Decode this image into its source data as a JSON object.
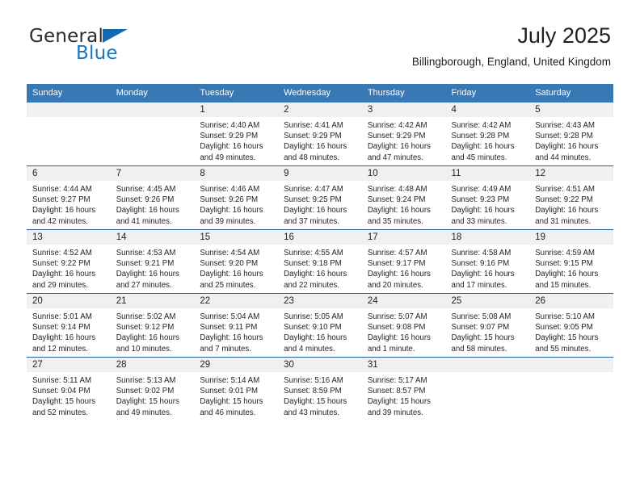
{
  "logo": {
    "word_top": "General",
    "word_bottom": "Blue",
    "triangle_icon": "triangle-icon",
    "blue": "#1b75bb"
  },
  "header": {
    "title": "July 2025",
    "subtitle": "Billingborough, England, United Kingdom"
  },
  "colors": {
    "header_row": "#3778b5",
    "day_band": "#f0f0f0",
    "row_divider": "#2a6099",
    "text": "#231f20"
  },
  "weekday_headers": [
    "Sunday",
    "Monday",
    "Tuesday",
    "Wednesday",
    "Thursday",
    "Friday",
    "Saturday"
  ],
  "weeks": [
    [
      {
        "day": "",
        "sunrise": "",
        "sunset": "",
        "daylight_1": "",
        "daylight_2": ""
      },
      {
        "day": "",
        "sunrise": "",
        "sunset": "",
        "daylight_1": "",
        "daylight_2": ""
      },
      {
        "day": "1",
        "sunrise": "Sunrise: 4:40 AM",
        "sunset": "Sunset: 9:29 PM",
        "daylight_1": "Daylight: 16 hours",
        "daylight_2": "and 49 minutes."
      },
      {
        "day": "2",
        "sunrise": "Sunrise: 4:41 AM",
        "sunset": "Sunset: 9:29 PM",
        "daylight_1": "Daylight: 16 hours",
        "daylight_2": "and 48 minutes."
      },
      {
        "day": "3",
        "sunrise": "Sunrise: 4:42 AM",
        "sunset": "Sunset: 9:29 PM",
        "daylight_1": "Daylight: 16 hours",
        "daylight_2": "and 47 minutes."
      },
      {
        "day": "4",
        "sunrise": "Sunrise: 4:42 AM",
        "sunset": "Sunset: 9:28 PM",
        "daylight_1": "Daylight: 16 hours",
        "daylight_2": "and 45 minutes."
      },
      {
        "day": "5",
        "sunrise": "Sunrise: 4:43 AM",
        "sunset": "Sunset: 9:28 PM",
        "daylight_1": "Daylight: 16 hours",
        "daylight_2": "and 44 minutes."
      }
    ],
    [
      {
        "day": "6",
        "sunrise": "Sunrise: 4:44 AM",
        "sunset": "Sunset: 9:27 PM",
        "daylight_1": "Daylight: 16 hours",
        "daylight_2": "and 42 minutes."
      },
      {
        "day": "7",
        "sunrise": "Sunrise: 4:45 AM",
        "sunset": "Sunset: 9:26 PM",
        "daylight_1": "Daylight: 16 hours",
        "daylight_2": "and 41 minutes."
      },
      {
        "day": "8",
        "sunrise": "Sunrise: 4:46 AM",
        "sunset": "Sunset: 9:26 PM",
        "daylight_1": "Daylight: 16 hours",
        "daylight_2": "and 39 minutes."
      },
      {
        "day": "9",
        "sunrise": "Sunrise: 4:47 AM",
        "sunset": "Sunset: 9:25 PM",
        "daylight_1": "Daylight: 16 hours",
        "daylight_2": "and 37 minutes."
      },
      {
        "day": "10",
        "sunrise": "Sunrise: 4:48 AM",
        "sunset": "Sunset: 9:24 PM",
        "daylight_1": "Daylight: 16 hours",
        "daylight_2": "and 35 minutes."
      },
      {
        "day": "11",
        "sunrise": "Sunrise: 4:49 AM",
        "sunset": "Sunset: 9:23 PM",
        "daylight_1": "Daylight: 16 hours",
        "daylight_2": "and 33 minutes."
      },
      {
        "day": "12",
        "sunrise": "Sunrise: 4:51 AM",
        "sunset": "Sunset: 9:22 PM",
        "daylight_1": "Daylight: 16 hours",
        "daylight_2": "and 31 minutes."
      }
    ],
    [
      {
        "day": "13",
        "sunrise": "Sunrise: 4:52 AM",
        "sunset": "Sunset: 9:22 PM",
        "daylight_1": "Daylight: 16 hours",
        "daylight_2": "and 29 minutes."
      },
      {
        "day": "14",
        "sunrise": "Sunrise: 4:53 AM",
        "sunset": "Sunset: 9:21 PM",
        "daylight_1": "Daylight: 16 hours",
        "daylight_2": "and 27 minutes."
      },
      {
        "day": "15",
        "sunrise": "Sunrise: 4:54 AM",
        "sunset": "Sunset: 9:20 PM",
        "daylight_1": "Daylight: 16 hours",
        "daylight_2": "and 25 minutes."
      },
      {
        "day": "16",
        "sunrise": "Sunrise: 4:55 AM",
        "sunset": "Sunset: 9:18 PM",
        "daylight_1": "Daylight: 16 hours",
        "daylight_2": "and 22 minutes."
      },
      {
        "day": "17",
        "sunrise": "Sunrise: 4:57 AM",
        "sunset": "Sunset: 9:17 PM",
        "daylight_1": "Daylight: 16 hours",
        "daylight_2": "and 20 minutes."
      },
      {
        "day": "18",
        "sunrise": "Sunrise: 4:58 AM",
        "sunset": "Sunset: 9:16 PM",
        "daylight_1": "Daylight: 16 hours",
        "daylight_2": "and 17 minutes."
      },
      {
        "day": "19",
        "sunrise": "Sunrise: 4:59 AM",
        "sunset": "Sunset: 9:15 PM",
        "daylight_1": "Daylight: 16 hours",
        "daylight_2": "and 15 minutes."
      }
    ],
    [
      {
        "day": "20",
        "sunrise": "Sunrise: 5:01 AM",
        "sunset": "Sunset: 9:14 PM",
        "daylight_1": "Daylight: 16 hours",
        "daylight_2": "and 12 minutes."
      },
      {
        "day": "21",
        "sunrise": "Sunrise: 5:02 AM",
        "sunset": "Sunset: 9:12 PM",
        "daylight_1": "Daylight: 16 hours",
        "daylight_2": "and 10 minutes."
      },
      {
        "day": "22",
        "sunrise": "Sunrise: 5:04 AM",
        "sunset": "Sunset: 9:11 PM",
        "daylight_1": "Daylight: 16 hours",
        "daylight_2": "and 7 minutes."
      },
      {
        "day": "23",
        "sunrise": "Sunrise: 5:05 AM",
        "sunset": "Sunset: 9:10 PM",
        "daylight_1": "Daylight: 16 hours",
        "daylight_2": "and 4 minutes."
      },
      {
        "day": "24",
        "sunrise": "Sunrise: 5:07 AM",
        "sunset": "Sunset: 9:08 PM",
        "daylight_1": "Daylight: 16 hours",
        "daylight_2": "and 1 minute."
      },
      {
        "day": "25",
        "sunrise": "Sunrise: 5:08 AM",
        "sunset": "Sunset: 9:07 PM",
        "daylight_1": "Daylight: 15 hours",
        "daylight_2": "and 58 minutes."
      },
      {
        "day": "26",
        "sunrise": "Sunrise: 5:10 AM",
        "sunset": "Sunset: 9:05 PM",
        "daylight_1": "Daylight: 15 hours",
        "daylight_2": "and 55 minutes."
      }
    ],
    [
      {
        "day": "27",
        "sunrise": "Sunrise: 5:11 AM",
        "sunset": "Sunset: 9:04 PM",
        "daylight_1": "Daylight: 15 hours",
        "daylight_2": "and 52 minutes."
      },
      {
        "day": "28",
        "sunrise": "Sunrise: 5:13 AM",
        "sunset": "Sunset: 9:02 PM",
        "daylight_1": "Daylight: 15 hours",
        "daylight_2": "and 49 minutes."
      },
      {
        "day": "29",
        "sunrise": "Sunrise: 5:14 AM",
        "sunset": "Sunset: 9:01 PM",
        "daylight_1": "Daylight: 15 hours",
        "daylight_2": "and 46 minutes."
      },
      {
        "day": "30",
        "sunrise": "Sunrise: 5:16 AM",
        "sunset": "Sunset: 8:59 PM",
        "daylight_1": "Daylight: 15 hours",
        "daylight_2": "and 43 minutes."
      },
      {
        "day": "31",
        "sunrise": "Sunrise: 5:17 AM",
        "sunset": "Sunset: 8:57 PM",
        "daylight_1": "Daylight: 15 hours",
        "daylight_2": "and 39 minutes."
      },
      {
        "day": "",
        "sunrise": "",
        "sunset": "",
        "daylight_1": "",
        "daylight_2": ""
      },
      {
        "day": "",
        "sunrise": "",
        "sunset": "",
        "daylight_1": "",
        "daylight_2": ""
      }
    ]
  ]
}
